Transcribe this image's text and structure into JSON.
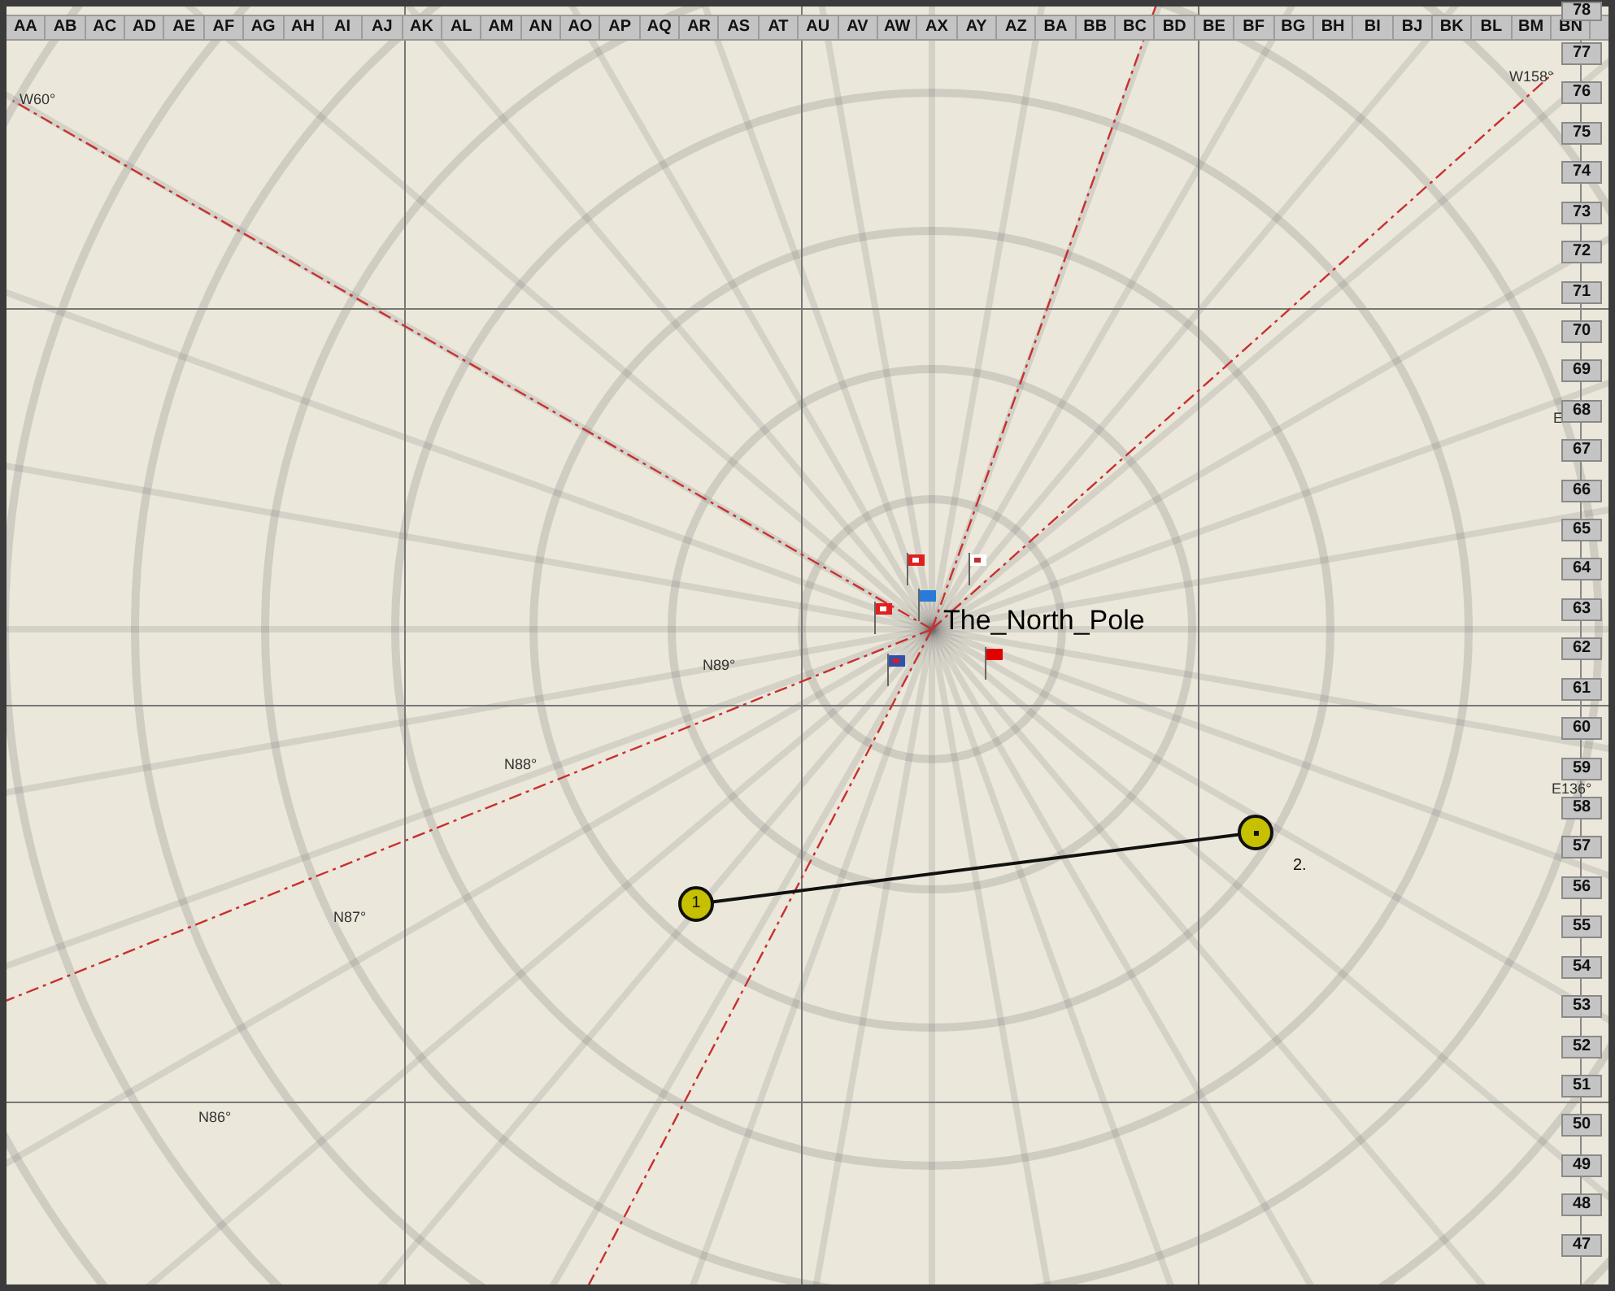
{
  "column_headers": [
    "AA",
    "AB",
    "AC",
    "AD",
    "AE",
    "AF",
    "AG",
    "AH",
    "AI",
    "AJ",
    "AK",
    "AL",
    "AM",
    "AN",
    "AO",
    "AP",
    "AQ",
    "AR",
    "AS",
    "AT",
    "AU",
    "AV",
    "AW",
    "AX",
    "AY",
    "AZ",
    "BA",
    "BB",
    "BC",
    "BD",
    "BE",
    "BF",
    "BG",
    "BH",
    "BI",
    "BJ",
    "BK",
    "BL",
    "BM",
    "BN"
  ],
  "row_headers": [
    "78",
    "77",
    "76",
    "75",
    "74",
    "73",
    "72",
    "71",
    "70",
    "69",
    "68",
    "67",
    "66",
    "65",
    "64",
    "63",
    "62",
    "61",
    "60",
    "59",
    "58",
    "57",
    "56",
    "55",
    "54",
    "53",
    "52",
    "51",
    "50",
    "49",
    "48",
    "47"
  ],
  "meridian_labels": [
    "W60°",
    "W158°",
    "E",
    "E136°"
  ],
  "parallel_labels": [
    "N89°",
    "N88°",
    "N87°",
    "N86°"
  ],
  "place_label": "The_North_Pole",
  "waypoints": [
    {
      "label": "1",
      "kind": "inside"
    },
    {
      "label": "2.",
      "kind": "beside"
    }
  ]
}
